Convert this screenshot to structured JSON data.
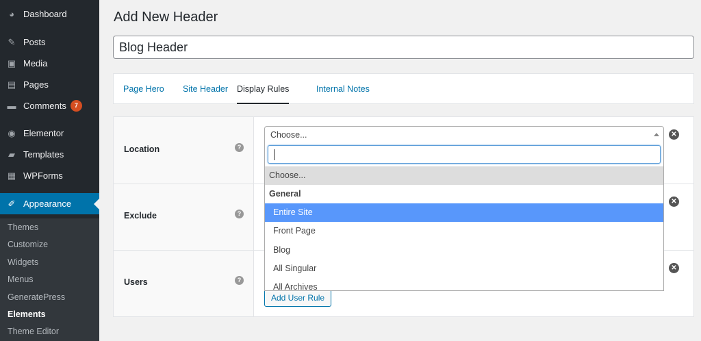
{
  "sidebar": {
    "items": [
      {
        "label": "Dashboard",
        "icon": "dashboard-icon",
        "glyph": "◕"
      },
      {
        "label": "Posts",
        "icon": "pushpin-icon",
        "glyph": "✎"
      },
      {
        "label": "Media",
        "icon": "media-icon",
        "glyph": "▣"
      },
      {
        "label": "Pages",
        "icon": "pages-icon",
        "glyph": "▤"
      },
      {
        "label": "Comments",
        "icon": "comments-icon",
        "glyph": "▬",
        "badge": "7"
      },
      {
        "label": "Elementor",
        "icon": "elementor-icon",
        "glyph": "◉"
      },
      {
        "label": "Templates",
        "icon": "folder-icon",
        "glyph": "▰"
      },
      {
        "label": "WPForms",
        "icon": "wpforms-icon",
        "glyph": "▦"
      },
      {
        "label": "Appearance",
        "icon": "paintbrush-icon",
        "glyph": "✐"
      }
    ],
    "submenu": [
      "Themes",
      "Customize",
      "Widgets",
      "Menus",
      "GeneratePress",
      "Elements",
      "Theme Editor"
    ]
  },
  "page": {
    "title": "Add New Header",
    "title_value": "Blog Header"
  },
  "tabs": [
    "Page Hero",
    "Site Header",
    "Display Rules",
    "Internal Notes"
  ],
  "rules": {
    "location_label": "Location",
    "exclude_label": "Exclude",
    "users_label": "Users",
    "help_glyph": "?",
    "remove_glyph": "✕",
    "add_user_rule": "Add User Rule"
  },
  "select": {
    "value": "Choose...",
    "options": {
      "first": "Choose...",
      "group": "General",
      "items": [
        "Entire Site",
        "Front Page",
        "Blog",
        "All Singular",
        "All Archives"
      ]
    }
  },
  "colors": {
    "sidebar_bg": "#23282d",
    "active_bg": "#0073aa",
    "highlight": "#5897fb",
    "badge": "#d54e21"
  }
}
